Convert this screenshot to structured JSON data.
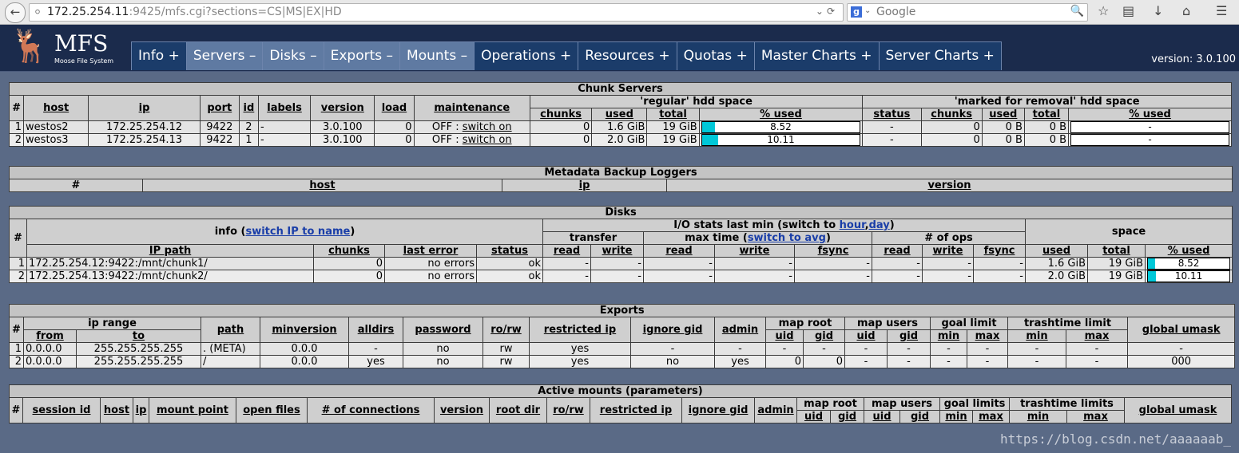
{
  "browser": {
    "url_host": "172.25.254.11",
    "url_rest": ":9425/mfs.cgi?sections=CS|MS|EX|HD",
    "search_engine_icon": "google-icon",
    "search_placeholder": "Google"
  },
  "header": {
    "logo_text": "MFS",
    "logo_subtitle": "Moose File System",
    "tabs": [
      "Info +",
      "Servers –",
      "Disks –",
      "Exports –",
      "Mounts –",
      "Operations +",
      "Resources +",
      "Quotas +",
      "Master Charts +",
      "Server Charts +"
    ],
    "version": "version: 3.0.100"
  },
  "chunk_servers": {
    "title": "Chunk Servers",
    "headers": {
      "num": "#",
      "host": "host",
      "ip": "ip",
      "port": "port",
      "id": "id",
      "labels": "labels",
      "version": "version",
      "load": "load",
      "maintenance": "maintenance",
      "regular": "'regular' hdd space",
      "removal": "'marked for removal' hdd space",
      "chunks": "chunks",
      "used": "used",
      "total": "total",
      "pct_used": "% used",
      "status": "status"
    },
    "rows": [
      {
        "num": "1",
        "host": "westos2",
        "ip": "172.25.254.12",
        "port": "9422",
        "id": "2",
        "labels": "-",
        "version": "3.0.100",
        "load": "0",
        "maint_prefix": "OFF : ",
        "maint_link": "switch on",
        "chunks": "0",
        "used": "1.6 GiB",
        "total": "19 GiB",
        "pct": "8.52",
        "pct_value": 8.52,
        "r_status": "-",
        "r_chunks": "0",
        "r_used": "0 B",
        "r_total": "0 B",
        "r_pct": "-"
      },
      {
        "num": "2",
        "host": "westos3",
        "ip": "172.25.254.13",
        "port": "9422",
        "id": "1",
        "labels": "-",
        "version": "3.0.100",
        "load": "0",
        "maint_prefix": "OFF : ",
        "maint_link": "switch on",
        "chunks": "0",
        "used": "2.0 GiB",
        "total": "19 GiB",
        "pct": "10.11",
        "pct_value": 10.11,
        "r_status": "-",
        "r_chunks": "0",
        "r_used": "0 B",
        "r_total": "0 B",
        "r_pct": "-"
      }
    ]
  },
  "metadata_loggers": {
    "title": "Metadata Backup Loggers",
    "headers": {
      "num": "#",
      "host": "host",
      "ip": "ip",
      "version": "version"
    }
  },
  "disks": {
    "title": "Disks",
    "info_prefix": "info (",
    "info_link": "switch IP to name",
    "info_suffix": ")",
    "io_prefix": "I/O stats last min (switch to ",
    "io_link_hour": "hour",
    "io_sep": ",",
    "io_link_day": "day",
    "io_suffix": ")",
    "transfer": "transfer",
    "maxtime_prefix": "max time (",
    "maxtime_link": "switch to avg",
    "maxtime_suffix": ")",
    "ops": "# of ops",
    "space": "space",
    "headers": {
      "num": "#",
      "ip_path": "IP path",
      "chunks": "chunks",
      "last_error": "last error",
      "status": "status",
      "read": "read",
      "write": "write",
      "fsync": "fsync",
      "used": "used",
      "total": "total",
      "pct_used": "% used"
    },
    "rows": [
      {
        "num": "1",
        "path": "172.25.254.12:9422:/mnt/chunk1/",
        "chunks": "0",
        "last_error": "no errors",
        "status": "ok",
        "dash": "-",
        "used": "1.6 GiB",
        "total": "19 GiB",
        "pct": "8.52",
        "pct_value": 8.52
      },
      {
        "num": "2",
        "path": "172.25.254.13:9422:/mnt/chunk2/",
        "chunks": "0",
        "last_error": "no errors",
        "status": "ok",
        "dash": "-",
        "used": "2.0 GiB",
        "total": "19 GiB",
        "pct": "10.11",
        "pct_value": 10.11
      }
    ]
  },
  "exports": {
    "title": "Exports",
    "headers": {
      "num": "#",
      "ip_range": "ip range",
      "from": "from",
      "to": "to",
      "path": "path",
      "minversion": "minversion",
      "alldirs": "alldirs",
      "password": "password",
      "rorw": "ro/rw",
      "restricted_ip": "restricted ip",
      "ignore_gid": "ignore gid",
      "admin": "admin",
      "map_root": "map root",
      "map_users": "map users",
      "goal_limit": "goal limit",
      "trashtime_limit": "trashtime limit",
      "global_umask": "global umask",
      "uid": "uid",
      "gid": "gid",
      "min": "min",
      "max": "max"
    },
    "rows": [
      {
        "num": "1",
        "from": "0.0.0.0",
        "to": "255.255.255.255",
        "path": ". (META)",
        "minversion": "0.0.0",
        "alldirs": "-",
        "password": "no",
        "rorw": "rw",
        "restricted_ip": "yes",
        "ignore_gid": "-",
        "admin": "-",
        "mr_uid": "-",
        "mr_gid": "-",
        "mu_uid": "-",
        "mu_gid": "-",
        "g_min": "-",
        "g_max": "-",
        "t_min": "-",
        "t_max": "-",
        "umask": "-"
      },
      {
        "num": "2",
        "from": "0.0.0.0",
        "to": "255.255.255.255",
        "path": "/",
        "minversion": "0.0.0",
        "alldirs": "yes",
        "password": "no",
        "rorw": "rw",
        "restricted_ip": "yes",
        "ignore_gid": "no",
        "admin": "yes",
        "mr_uid": "0",
        "mr_gid": "0",
        "mu_uid": "-",
        "mu_gid": "-",
        "g_min": "-",
        "g_max": "-",
        "t_min": "-",
        "t_max": "-",
        "umask": "000"
      }
    ]
  },
  "active_mounts": {
    "title": "Active mounts (parameters)",
    "headers": {
      "num": "#",
      "session_id": "session id",
      "host": "host",
      "ip": "ip",
      "mount_point": "mount point",
      "open_files": "open files",
      "connections": "# of connections",
      "version": "version",
      "root_dir": "root dir",
      "rorw": "ro/rw",
      "restricted_ip": "restricted ip",
      "ignore_gid": "ignore gid",
      "admin": "admin",
      "map_root": "map root",
      "map_users": "map users",
      "goal_limits": "goal limits",
      "trashtime_limits": "trashtime limits",
      "global_umask": "global umask",
      "uid": "uid",
      "gid": "gid",
      "min": "min",
      "max": "max"
    }
  },
  "watermark": "https://blog.csdn.net/aaaaaab_"
}
